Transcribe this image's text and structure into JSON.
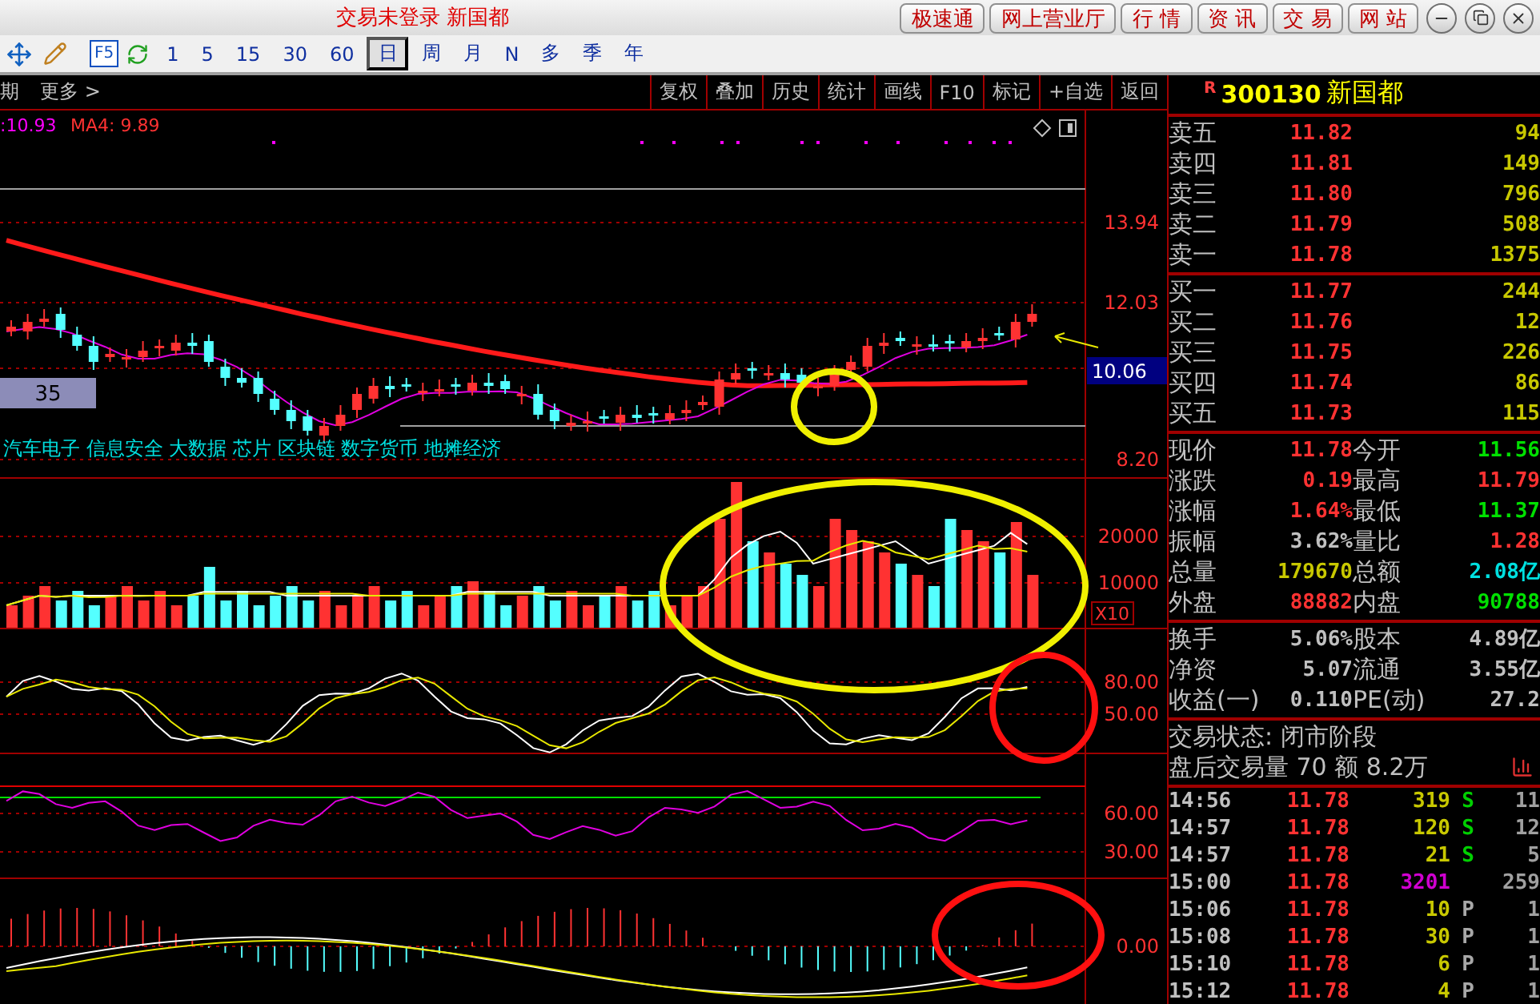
{
  "window": {
    "title": "交易未登录 新国都",
    "links": [
      "极速通",
      "网上营业厅",
      "行 情",
      "资 讯",
      "交 易",
      "网 站"
    ]
  },
  "toolbar": {
    "f5_label": "F5",
    "periods": [
      {
        "label": "1",
        "selected": false
      },
      {
        "label": "5",
        "selected": false
      },
      {
        "label": "15",
        "selected": false
      },
      {
        "label": "30",
        "selected": false
      },
      {
        "label": "60",
        "selected": false
      },
      {
        "label": "日",
        "selected": true
      },
      {
        "label": "周",
        "selected": false
      },
      {
        "label": "月",
        "selected": false
      },
      {
        "label": "N",
        "selected": false
      },
      {
        "label": "多",
        "selected": false
      },
      {
        "label": "季",
        "selected": false
      },
      {
        "label": "年",
        "selected": false
      }
    ]
  },
  "chart_toolbar": {
    "period_fragment": "期",
    "more": "更多 >",
    "buttons": [
      "复权",
      "叠加",
      "历史",
      "统计",
      "画线",
      "F10",
      "标记",
      "+自选",
      "返回"
    ]
  },
  "price_panel": {
    "legend": [
      {
        "text": ":10.93",
        "color": "#ff00ff"
      },
      {
        "text": "MA4: 9.89",
        "color": "#ff3232"
      }
    ],
    "ticks": [
      "13.94",
      "12.03",
      "8.20"
    ],
    "price_tag": "10.06",
    "badge": "35",
    "concepts": "汽车电子 信息安全 大数据 芯片 区块链 数字货币 地摊经济"
  },
  "volume_panel": {
    "ticks": [
      "20000",
      "10000"
    ],
    "unit": "X10"
  },
  "kdj_panel": {
    "ticks": [
      "80.00",
      "50.00"
    ]
  },
  "rsi_panel": {
    "ticks": [
      "60.00",
      "30.00"
    ]
  },
  "macd_panel": {
    "ticks": [
      "0.00"
    ]
  },
  "quote": {
    "mark": "R",
    "code": "300130",
    "name": "新国都"
  },
  "order_book": {
    "sell": [
      {
        "label": "卖五",
        "price": "11.82",
        "volume": "94"
      },
      {
        "label": "卖四",
        "price": "11.81",
        "volume": "149"
      },
      {
        "label": "卖三",
        "price": "11.80",
        "volume": "796"
      },
      {
        "label": "卖二",
        "price": "11.79",
        "volume": "508"
      },
      {
        "label": "卖一",
        "price": "11.78",
        "volume": "1375"
      }
    ],
    "buy": [
      {
        "label": "买一",
        "price": "11.77",
        "volume": "244"
      },
      {
        "label": "买二",
        "price": "11.76",
        "volume": "12"
      },
      {
        "label": "买三",
        "price": "11.75",
        "volume": "226"
      },
      {
        "label": "买四",
        "price": "11.74",
        "volume": "86"
      },
      {
        "label": "买五",
        "price": "11.73",
        "volume": "115"
      }
    ]
  },
  "stats": [
    [
      {
        "left": {
          "label": "现价",
          "value": "11.78",
          "color": "#ff3232"
        },
        "right": {
          "label": "今开",
          "value": "11.56",
          "color": "#00e000"
        }
      },
      {
        "left": {
          "label": "涨跌",
          "value": "0.19",
          "color": "#ff3232"
        },
        "right": {
          "label": "最高",
          "value": "11.79",
          "color": "#ff3232"
        }
      },
      {
        "left": {
          "label": "涨幅",
          "value": "1.64%",
          "color": "#ff3232"
        },
        "right": {
          "label": "最低",
          "value": "11.37",
          "color": "#00e000"
        }
      },
      {
        "left": {
          "label": "振幅",
          "value": "3.62%",
          "color": "#c0c0c0"
        },
        "right": {
          "label": "量比",
          "value": "1.28",
          "color": "#ff3232"
        }
      },
      {
        "left": {
          "label": "总量",
          "value": "179670",
          "color": "#c8c800"
        },
        "right": {
          "label": "总额",
          "value": "2.08亿",
          "color": "#00e0e0"
        }
      },
      {
        "left": {
          "label": "外盘",
          "value": "88882",
          "color": "#ff3232"
        },
        "right": {
          "label": "内盘",
          "value": "90788",
          "color": "#00e000"
        }
      }
    ],
    [
      {
        "left": {
          "label": "换手",
          "value": "5.06%",
          "color": "#c0c0c0"
        },
        "right": {
          "label": "股本",
          "value": "4.89亿",
          "color": "#c0c0c0"
        }
      },
      {
        "left": {
          "label": "净资",
          "value": "5.07",
          "color": "#c0c0c0"
        },
        "right": {
          "label": "流通",
          "value": "3.55亿",
          "color": "#c0c0c0"
        }
      },
      {
        "left": {
          "label": "收益(一)",
          "value": "0.110",
          "color": "#c0c0c0"
        },
        "right": {
          "label": "PE(动)",
          "value": "27.2",
          "color": "#c0c0c0"
        }
      }
    ]
  ],
  "status": [
    "交易状态: 闭市阶段",
    "盘后交易量 70 额 8.2万"
  ],
  "trades": [
    {
      "time": "14:56",
      "price": "11.78",
      "volume": "319",
      "color": "#c8c800",
      "flag": "S",
      "kind": "sell",
      "count": "11"
    },
    {
      "time": "14:57",
      "price": "11.78",
      "volume": "120",
      "color": "#c8c800",
      "flag": "S",
      "kind": "sell",
      "count": "12"
    },
    {
      "time": "14:57",
      "price": "11.78",
      "volume": "21",
      "color": "#c8c800",
      "flag": "S",
      "kind": "sell",
      "count": "5"
    },
    {
      "time": "15:00",
      "price": "11.78",
      "volume": "3201",
      "color": "#d000d0",
      "count": "259"
    },
    {
      "time": "15:06",
      "price": "11.78",
      "volume": "10",
      "color": "#c8c800",
      "flag": "P",
      "kind": "pass",
      "count": "1"
    },
    {
      "time": "15:08",
      "price": "11.78",
      "volume": "30",
      "color": "#c8c800",
      "flag": "P",
      "kind": "pass",
      "count": "1"
    },
    {
      "time": "15:10",
      "price": "11.78",
      "volume": "6",
      "color": "#c8c800",
      "flag": "P",
      "kind": "pass",
      "count": "1"
    },
    {
      "time": "15:12",
      "price": "11.78",
      "volume": "4",
      "color": "#c8c800",
      "flag": "P",
      "kind": "pass",
      "count": "1"
    }
  ]
}
